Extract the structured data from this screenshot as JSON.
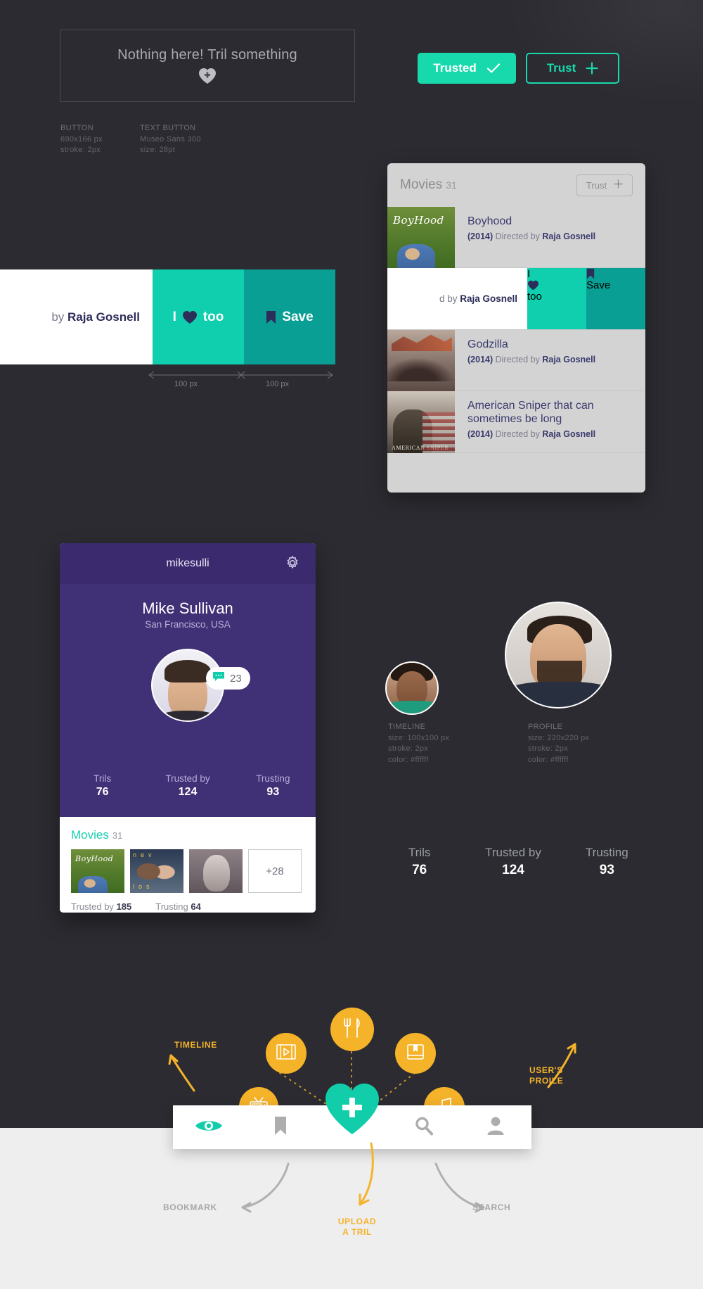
{
  "theme": {
    "bg": "#2b2b31",
    "accent_teal": "#18d9ab",
    "accent_teal_dark": "#0a9f94",
    "purple": "#403076",
    "purple_dark": "#3b2a6e",
    "orange": "#f5b32a",
    "light_band": "#eeeeee"
  },
  "empty_state": {
    "message": "Nothing here! Tril something",
    "icon": "heart-plus-icon"
  },
  "specs": {
    "button": {
      "caption": "BUTTON",
      "line1": "690x166 px",
      "line2": "stroke: 2px"
    },
    "text_button": {
      "caption": "TEXT BUTTON",
      "line1": "Museo Sans 300",
      "line2": "size: 28pt"
    },
    "timeline_avatar": {
      "caption": "TIMELINE",
      "line1": "size: 100x100 px",
      "line2": "stroke: 2px",
      "line3": "color: #ffffff"
    },
    "profile_avatar": {
      "caption": "PROFILE",
      "line1": "size: 220x220 px",
      "line2": "stroke: 2px",
      "line3": "color: #ffffff"
    }
  },
  "trust_buttons": {
    "trusted_label": "Trusted",
    "trusted_icon": "check-icon",
    "trust_label": "Trust",
    "trust_icon": "plus-icon"
  },
  "swipe_demo": {
    "meta_prefix": "by ",
    "meta_director": "Raja Gosnell",
    "love_label": "too",
    "love_prefix": "I",
    "love_icon": "heart-icon",
    "save_label": "Save",
    "save_icon": "bookmark-icon",
    "measure_left": "100 px",
    "measure_right": "100 px"
  },
  "movies_card": {
    "title": "Movies",
    "count": "31",
    "trust_label": "Trust",
    "trust_icon": "plus-icon",
    "rows": [
      {
        "title": "Boyhood",
        "year": "(2014)",
        "by": "Directed by",
        "director": "Raja Gosnell",
        "poster": "boyhood"
      },
      {
        "title": "Godzilla",
        "year": "(2014)",
        "by": "Directed by",
        "director": "Raja Gosnell",
        "poster": "godzilla"
      },
      {
        "title": "American Sniper that can sometimes be long",
        "year": "(2014)",
        "by": "Directed by",
        "director": "Raja Gosnell",
        "poster": "sniper"
      }
    ],
    "swipe_row": {
      "meta_prefix": "d by ",
      "meta_director": "Raja Gosnell",
      "love_prefix": "I",
      "love_label": "too",
      "save_label": "Save"
    }
  },
  "profile_card": {
    "username": "mikesulli",
    "gear_icon": "gear-icon",
    "name": "Mike Sullivan",
    "location": "San Francisco, USA",
    "message_badge": {
      "icon": "comment-icon",
      "count": "23"
    },
    "stats": [
      {
        "label": "Trils",
        "value": "76"
      },
      {
        "label": "Trusted by",
        "value": "124"
      },
      {
        "label": "Trusting",
        "value": "93"
      }
    ],
    "section": {
      "title": "Movies",
      "count": "31",
      "more": "+28"
    },
    "footer": [
      {
        "label": "Trusted by",
        "value": "185"
      },
      {
        "label": "Trusting",
        "value": "64"
      }
    ]
  },
  "standalone_stats": [
    {
      "label": "Trils",
      "value": "76"
    },
    {
      "label": "Trusted by",
      "value": "124"
    },
    {
      "label": "Trusting",
      "value": "93"
    }
  ],
  "nav": {
    "items": [
      {
        "name": "timeline",
        "icon": "eye-icon",
        "active": true
      },
      {
        "name": "bookmark",
        "icon": "bookmark-icon",
        "active": false
      },
      {
        "name": "upload",
        "icon": "heart-plus-icon",
        "active": true
      },
      {
        "name": "search",
        "icon": "search-icon",
        "active": false
      },
      {
        "name": "profile",
        "icon": "person-icon",
        "active": false
      }
    ],
    "bubbles": [
      {
        "name": "tv",
        "icon": "tv-icon"
      },
      {
        "name": "film",
        "icon": "film-icon"
      },
      {
        "name": "food",
        "icon": "fork-knife-icon"
      },
      {
        "name": "book",
        "icon": "book-icon"
      },
      {
        "name": "music",
        "icon": "music-note-icon"
      }
    ],
    "callouts": {
      "timeline": "TIMELINE",
      "users_profile_line1": "USER'S",
      "users_profile_line2": "PROILE",
      "bookmark": "BOOKMARK",
      "upload_line1": "UPLOAD",
      "upload_line2": "A TRIL",
      "search": "SEARCH"
    }
  }
}
